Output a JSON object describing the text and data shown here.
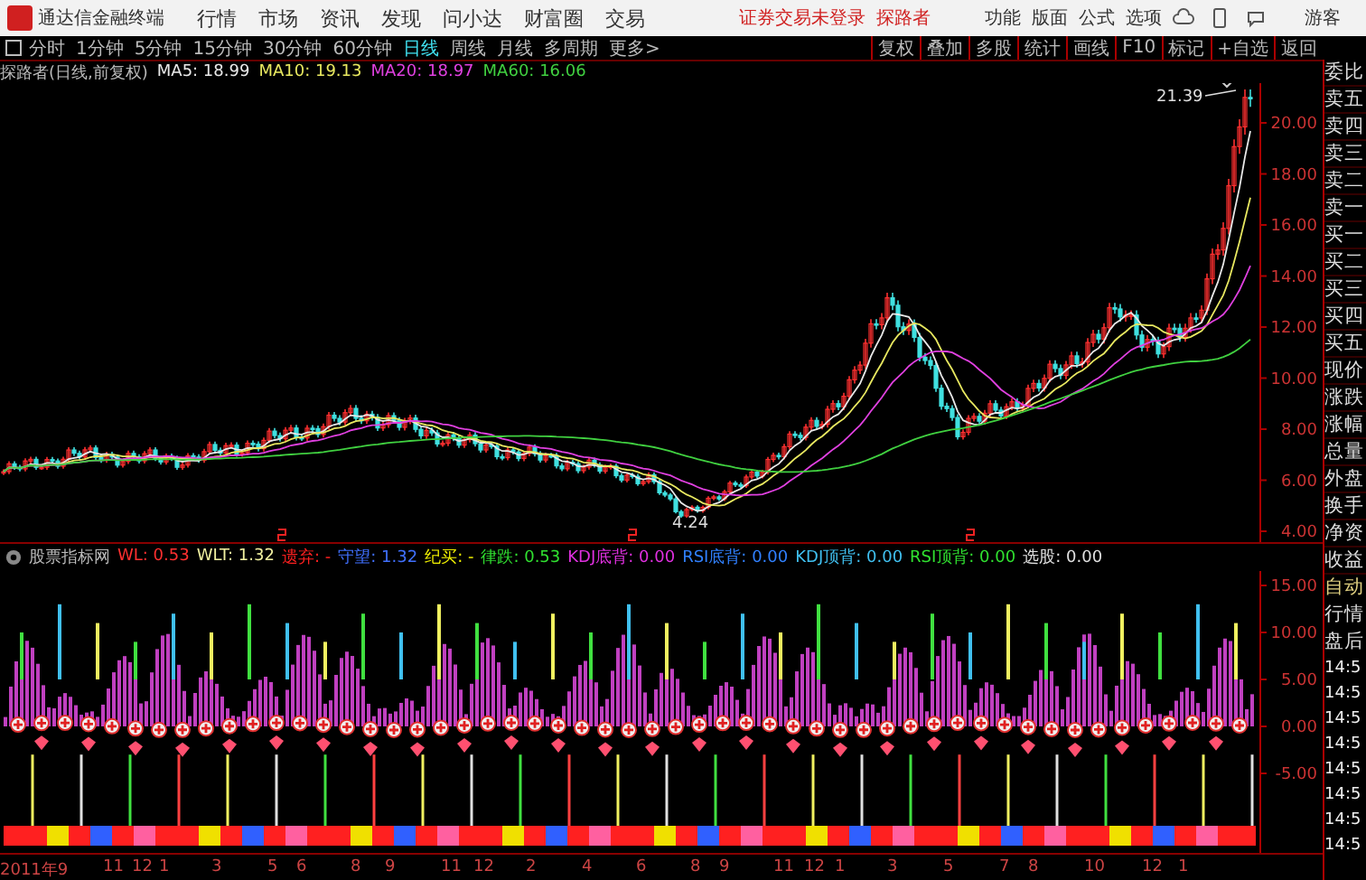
{
  "app": {
    "title": "通达信金融终端",
    "menu": [
      "行情",
      "市场",
      "资讯",
      "发现",
      "问小达",
      "财富圈",
      "交易"
    ],
    "login_status": "证券交易未登录",
    "stock_link": "探路者",
    "right_menu": [
      "功能",
      "版面",
      "公式",
      "选项"
    ],
    "user": "游客"
  },
  "periods": [
    {
      "label": "分时",
      "selected": false
    },
    {
      "label": "1分钟",
      "selected": false
    },
    {
      "label": "5分钟",
      "selected": false
    },
    {
      "label": "15分钟",
      "selected": false
    },
    {
      "label": "30分钟",
      "selected": false
    },
    {
      "label": "60分钟",
      "selected": false
    },
    {
      "label": "日线",
      "selected": true
    },
    {
      "label": "周线",
      "selected": false
    },
    {
      "label": "月线",
      "selected": false
    },
    {
      "label": "多周期",
      "selected": false
    },
    {
      "label": "更多>",
      "selected": false
    }
  ],
  "tools": [
    "复权",
    "叠加",
    "多股",
    "统计",
    "画线",
    "F10",
    "标记",
    "+自选",
    "返回"
  ],
  "chart_title": "探路者(日线,前复权)",
  "ma": [
    {
      "label": "MA5: 18.99",
      "color": "#e8e8e8"
    },
    {
      "label": "MA10: 19.13",
      "color": "#e8e860"
    },
    {
      "label": "MA20: 18.97",
      "color": "#e040e0"
    },
    {
      "label": "MA60: 16.06",
      "color": "#40d040"
    }
  ],
  "price_axis": [
    "20.00",
    "18.00",
    "16.00",
    "14.00",
    "12.00",
    "10.00",
    "8.00",
    "6.00",
    "4.00"
  ],
  "high_label": "21.39",
  "low_label": "4.24",
  "quote_labels": [
    "委比",
    "卖五",
    "卖四",
    "卖三",
    "卖二",
    "卖一",
    "买一",
    "买二",
    "买三",
    "买四",
    "买五",
    "现价",
    "涨跌",
    "涨幅",
    "总量",
    "外盘",
    "换手",
    "净资",
    "收益"
  ],
  "indicator": {
    "name": "股票指标网",
    "items": [
      {
        "label": "WL: 0.53",
        "color": "#ff3030"
      },
      {
        "label": "WLT: 1.32",
        "color": "#f0f0a0"
      },
      {
        "label": "遗弃: -",
        "color": "#ff2020"
      },
      {
        "label": "守望: 1.32",
        "color": "#4070ff"
      },
      {
        "label": "纪买: -",
        "color": "#f0f000"
      },
      {
        "label": "律跌: 0.53",
        "color": "#30e030"
      },
      {
        "label": "KDJ底背: 0.00",
        "color": "#e030e0"
      },
      {
        "label": "RSI底背: 0.00",
        "color": "#3080ff"
      },
      {
        "label": "KDJ顶背: 0.00",
        "color": "#40c0f0"
      },
      {
        "label": "RSI顶背: 0.00",
        "color": "#30e030"
      },
      {
        "label": "选股: 0.00",
        "color": "#e0e0e0"
      }
    ],
    "axis": [
      "15.00",
      "10.00",
      "5.00",
      "0.00",
      "-5.00"
    ]
  },
  "side_modes": [
    {
      "label": "自动",
      "selected": true
    },
    {
      "label": "行情",
      "selected": false
    },
    {
      "label": "盘后",
      "selected": false
    }
  ],
  "trade_times": [
    "14:5",
    "14:5",
    "14:5",
    "14:5",
    "14:5",
    "14:5",
    "14:5",
    "14:5"
  ],
  "date_axis": [
    "2011年9",
    "11",
    "12",
    "1",
    "3",
    "5",
    "6",
    "8",
    "9",
    "11",
    "12",
    "2",
    "4",
    "6",
    "8",
    "9",
    "11",
    "12",
    "1",
    "3",
    "5",
    "7",
    "8",
    "10",
    "12",
    "1"
  ]
}
